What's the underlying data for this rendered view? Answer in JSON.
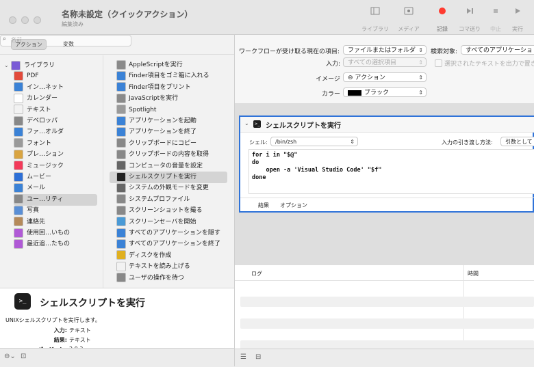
{
  "window": {
    "title": "名称未設定（クイックアクション）",
    "subtitle": "編集済み"
  },
  "toolbar": {
    "library_label": "ライブラリ",
    "media_label": "メディア",
    "record_label": "記録",
    "step_label": "コマ送り",
    "stop_label": "中止",
    "run_label": "実行",
    "record_color": "#ff3b30"
  },
  "left": {
    "tab_actions": "アクション",
    "tab_variables": "変数",
    "search_placeholder": "名前",
    "library_items": [
      {
        "label": "ライブラリ",
        "icon": "library-icon",
        "color": "#7a5bd6"
      },
      {
        "label": "PDF",
        "icon": "pdf-icon",
        "color": "#e24a3b"
      },
      {
        "label": "イン…ネット",
        "icon": "internet-icon",
        "color": "#3b82d6"
      },
      {
        "label": "カレンダー",
        "icon": "calendar-icon",
        "color": "#ffffff"
      },
      {
        "label": "テキスト",
        "icon": "text-icon",
        "color": "#f2f2f2"
      },
      {
        "label": "デベロッパ",
        "icon": "developer-icon",
        "color": "#888888"
      },
      {
        "label": "ファ…オルダ",
        "icon": "finder-icon",
        "color": "#3b82d6"
      },
      {
        "label": "フォント",
        "icon": "font-icon",
        "color": "#9a9a9a"
      },
      {
        "label": "プレ…ション",
        "icon": "presentation-icon",
        "color": "#d9a441"
      },
      {
        "label": "ミュージック",
        "icon": "music-icon",
        "color": "#f33a5a"
      },
      {
        "label": "ムービー",
        "icon": "movie-icon",
        "color": "#2d6fd6"
      },
      {
        "label": "メール",
        "icon": "mail-icon",
        "color": "#3b82d6"
      },
      {
        "label": "ユー…リティ",
        "icon": "utilities-icon",
        "color": "#888888"
      },
      {
        "label": "写真",
        "icon": "photos-icon",
        "color": "#5a8fd6"
      },
      {
        "label": "連絡先",
        "icon": "contacts-icon",
        "color": "#b58a5a"
      },
      {
        "label": "使用回…いもの",
        "icon": "most-used-icon",
        "color": "#b05ad6"
      },
      {
        "label": "最近追…たもの",
        "icon": "recently-added-icon",
        "color": "#b05ad6"
      }
    ],
    "action_items": [
      {
        "label": "AppleScriptを実行",
        "icon": "applescript-icon",
        "color": "#8a8a8a"
      },
      {
        "label": "Finder項目をゴミ箱に入れる",
        "icon": "finder-icon",
        "color": "#3b82d6"
      },
      {
        "label": "Finder項目をプリント",
        "icon": "finder-icon",
        "color": "#3b82d6"
      },
      {
        "label": "JavaScriptを実行",
        "icon": "javascript-icon",
        "color": "#8a8a8a"
      },
      {
        "label": "Spotlight",
        "icon": "spotlight-icon",
        "color": "#9a9a9a"
      },
      {
        "label": "アプリケーションを起動",
        "icon": "finder-icon",
        "color": "#3b82d6"
      },
      {
        "label": "アプリケーションを終了",
        "icon": "finder-icon",
        "color": "#3b82d6"
      },
      {
        "label": "クリップボードにコピー",
        "icon": "utilities-icon",
        "color": "#888888"
      },
      {
        "label": "クリップボードの内容を取得",
        "icon": "utilities-icon",
        "color": "#888888"
      },
      {
        "label": "コンピュータの音量を設定",
        "icon": "volume-icon",
        "color": "#666666"
      },
      {
        "label": "シェルスクリプトを実行",
        "icon": "terminal-icon",
        "color": "#222222"
      },
      {
        "label": "システムの外観モードを変更",
        "icon": "appearance-icon",
        "color": "#666666"
      },
      {
        "label": "システムプロファイル",
        "icon": "utilities-icon",
        "color": "#888888"
      },
      {
        "label": "スクリーンショットを撮る",
        "icon": "utilities-icon",
        "color": "#888888"
      },
      {
        "label": "スクリーンセーバを開始",
        "icon": "screensaver-icon",
        "color": "#4a9ad6"
      },
      {
        "label": "すべてのアプリケーションを隠す",
        "icon": "finder-icon",
        "color": "#3b82d6"
      },
      {
        "label": "すべてのアプリケーションを終了",
        "icon": "finder-icon",
        "color": "#3b82d6"
      },
      {
        "label": "ディスクを作成",
        "icon": "burn-icon",
        "color": "#e0b020"
      },
      {
        "label": "テキストを読み上げる",
        "icon": "text-icon",
        "color": "#f2f2f2"
      },
      {
        "label": "ユーザの操作を待つ",
        "icon": "utilities-icon",
        "color": "#888888"
      }
    ],
    "desc_title": "シェルスクリプトを実行",
    "desc_text": "UNIXシェルスクリプトを実行します。",
    "input_label": "入力:",
    "input_value": "テキスト",
    "result_label": "結果:",
    "result_value": "テキスト",
    "version_label": "バージョン:",
    "version_value": "2.0.3"
  },
  "workflow": {
    "receives_label": "ワークフローが受け取る現在の項目:",
    "receives_value": "ファイルまたはフォルダ",
    "target_label": "検索対象:",
    "target_value": "すべてのアプリケーショ",
    "input_label": "入力:",
    "input_value": "すべての選択項目",
    "replace_label": "選択されたテキストを出力で置き",
    "image_label": "イメージ",
    "image_value": "⊖ アクション",
    "color_label": "カラー",
    "color_value": "ブラック",
    "action_title": "シェルスクリプトを実行",
    "shell_label": "シェル:",
    "shell_value": "/bin/zsh",
    "pass_label": "入力の引き渡し方法:",
    "pass_value": "引数として",
    "script_lines": [
      "for i in \"$@\"",
      "do",
      "    open -a 'Visual Studio Code' \"$f\"",
      "done"
    ],
    "tab_results": "結果",
    "tab_options": "オプション",
    "log_col": "ログ",
    "time_col": "時間"
  }
}
